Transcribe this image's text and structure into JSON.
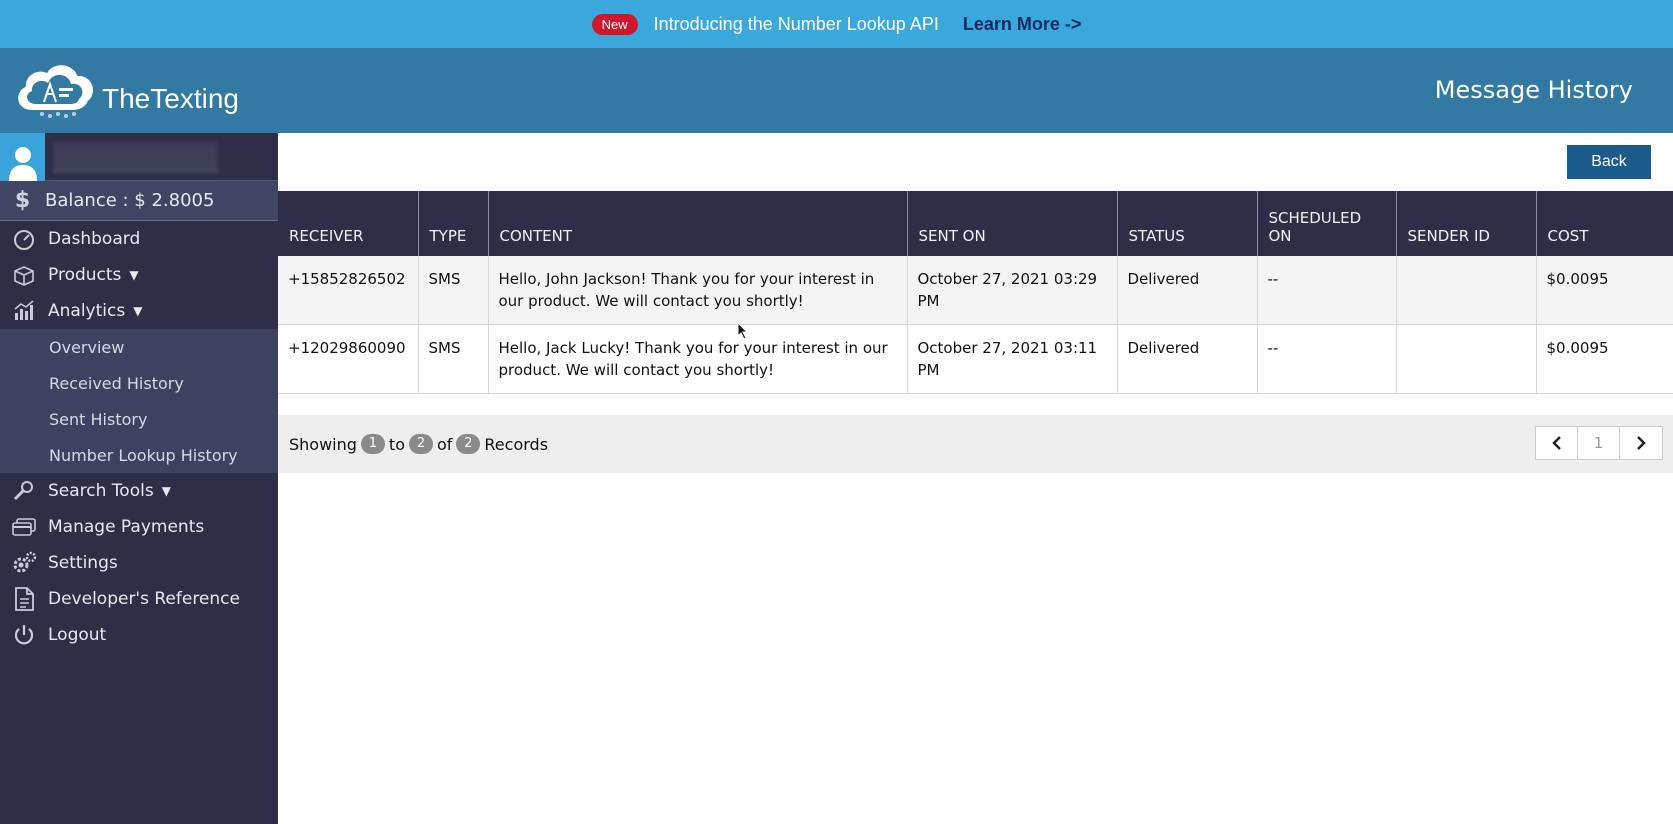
{
  "banner": {
    "badge": "New",
    "text": "Introducing the Number Lookup API",
    "link": "Learn More ->"
  },
  "header": {
    "brand": "TheTexting",
    "page_title": "Message History"
  },
  "sidebar": {
    "balance": "Balance : $ 2.8005",
    "items": [
      {
        "label": "Dashboard",
        "icon": "dashboard-icon"
      },
      {
        "label": "Products",
        "icon": "box-icon"
      },
      {
        "label": "Analytics",
        "icon": "analytics-icon"
      },
      {
        "label": "Search Tools",
        "icon": "search-tools-icon"
      },
      {
        "label": "Manage Payments",
        "icon": "payment-card-icon"
      },
      {
        "label": "Settings",
        "icon": "gear-icon"
      },
      {
        "label": "Developer's Reference",
        "icon": "document-icon"
      },
      {
        "label": "Logout",
        "icon": "power-icon"
      }
    ],
    "analytics_sub": [
      "Overview",
      "Received History",
      "Sent History",
      "Number Lookup History"
    ]
  },
  "main": {
    "back_label": "Back",
    "columns": [
      "RECEIVER",
      "TYPE",
      "CONTENT",
      "SENT ON",
      "STATUS",
      "SCHEDULED ON",
      "SENDER ID",
      "COST"
    ],
    "rows": [
      {
        "receiver": "+15852826502",
        "type": "SMS",
        "content": "Hello, John Jackson! Thank you for your interest in our product. We will contact you shortly!",
        "sent_on": "October 27, 2021 03:29 PM",
        "status": "Delivered",
        "scheduled_on": "--",
        "sender_id": "",
        "cost": "$0.0095"
      },
      {
        "receiver": "+12029860090",
        "type": "SMS",
        "content": "Hello, Jack Lucky! Thank you for your interest in our product. We will contact you shortly!",
        "sent_on": "October 27, 2021 03:11 PM",
        "status": "Delivered",
        "scheduled_on": "--",
        "sender_id": "",
        "cost": "$0.0095"
      }
    ],
    "pagination": {
      "showing": "Showing",
      "from": "1",
      "to_word": "to",
      "to": "2",
      "of_word": "of",
      "total": "2",
      "records_word": "Records",
      "current_page": "1"
    }
  },
  "colors": {
    "banner": "#3aa8dc",
    "header": "#327aa4",
    "sidebar": "#2d2f46",
    "new_badge": "#d0162d",
    "back_button": "#1b5b8c"
  }
}
